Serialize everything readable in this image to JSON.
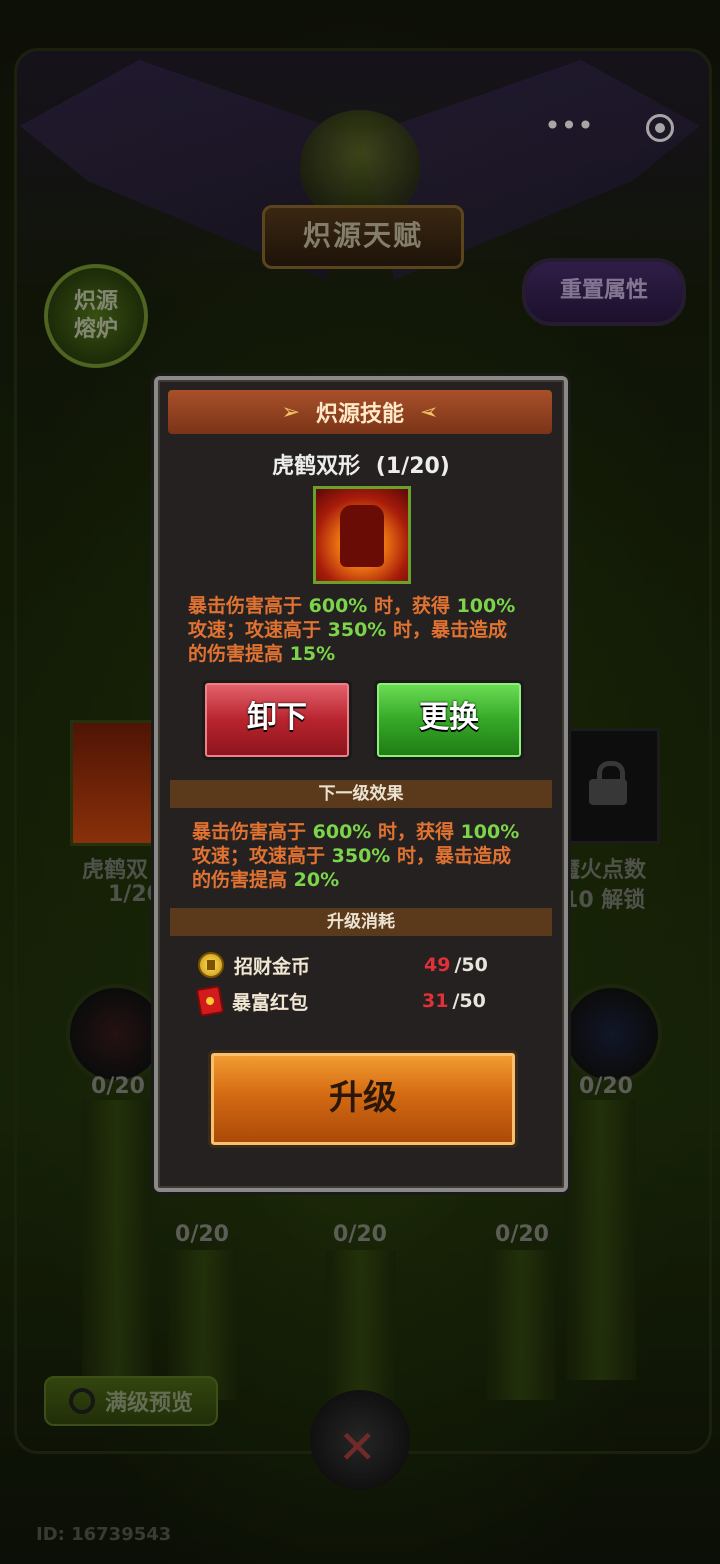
{
  "screen": {
    "title": "炽源天赋",
    "forge_button": "炽源\n熔炉",
    "reset_button": "重置属性",
    "top_more": "•••",
    "full_preview_button": "满级预览",
    "user_id": "ID: 16739543"
  },
  "background": {
    "left_card_label": "虎鹤双",
    "left_card_count": "1/20",
    "right_card_label": "魔火点数",
    "right_card_lock_note": "/10 解锁",
    "orb_counts": [
      "0/20",
      "0/20",
      "0/20",
      "0/20",
      "0/20"
    ]
  },
  "modal": {
    "header_title": "炽源技能",
    "skill_name": "虎鹤双形",
    "skill_level": "(1/20)",
    "current_effect": {
      "p1": "暴击伤害高于 ",
      "v1": "600%",
      "p2": " 时，获得 ",
      "v2": "100%",
      "p3": "攻速；攻速高于 ",
      "v3": "350%",
      "p4": " 时，暴击造成",
      "p5": "的伤害提高 ",
      "v4": "15%"
    },
    "unequip_button": "卸下",
    "replace_button": "更换",
    "next_level_header": "下一级效果",
    "next_effect": {
      "p1": "暴击伤害高于 ",
      "v1": "600%",
      "p2": " 时，获得 ",
      "v2": "100%",
      "p3": "攻速；攻速高于 ",
      "v3": "350%",
      "p4": " 时，暴击造成",
      "p5": "的伤害提高 ",
      "v4": "20%"
    },
    "cost_header": "升级消耗",
    "costs": [
      {
        "icon": "gold-coin-icon",
        "label": "招财金币",
        "have": "49",
        "need": "/50"
      },
      {
        "icon": "red-envelope-icon",
        "label": "暴富红包",
        "have": "31",
        "need": "/50"
      }
    ],
    "upgrade_button": "升级"
  },
  "colors": {
    "text_orange": "#e07232",
    "value_green": "#7cd44a",
    "insufficient_red": "#e0303a"
  }
}
